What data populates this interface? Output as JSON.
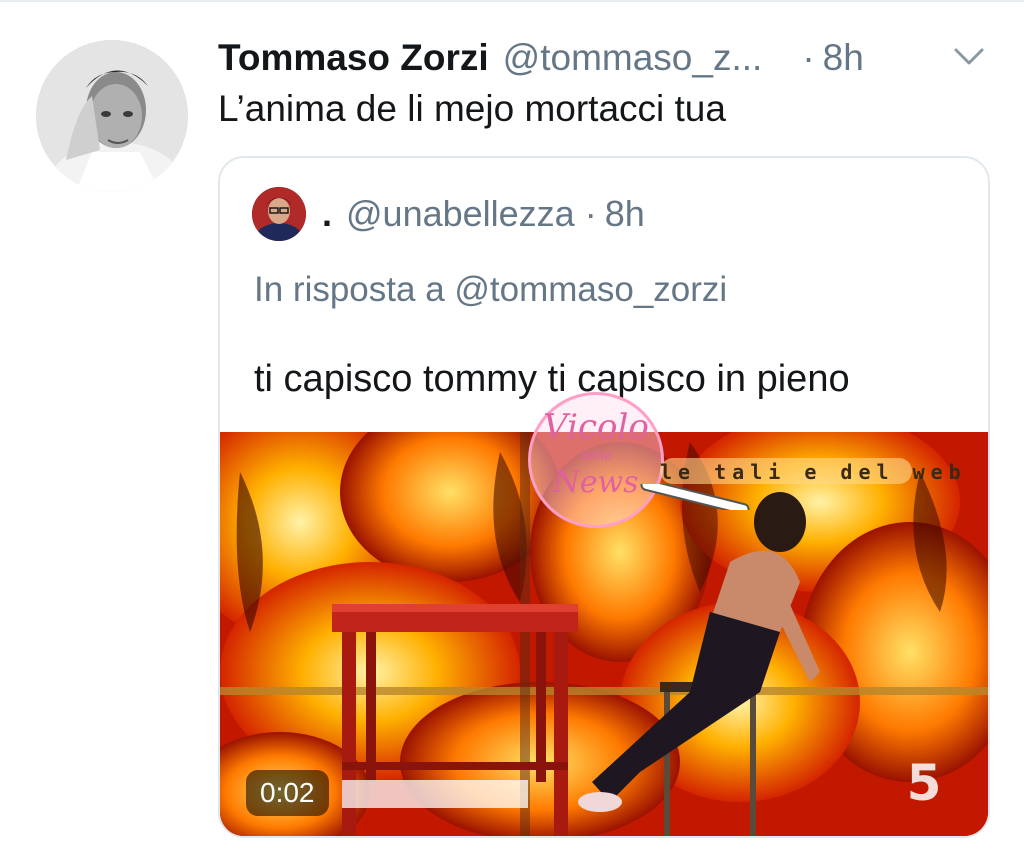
{
  "tweet": {
    "author_name": "Tommaso Zorzi",
    "author_handle": "@tommaso_z...",
    "separator": "·",
    "time": "8h",
    "text": "L’anima de li mejo mortacci tua"
  },
  "quoted_tweet": {
    "author_name": ".",
    "author_handle": "@unabellezza",
    "separator": "·",
    "time": "8h",
    "reply_to": "In risposta a @tommaso_zorzi",
    "text": "ti capisco tommy ti capisco in pieno",
    "media": {
      "duration": "0:02",
      "channel_logo": "5"
    }
  },
  "watermark": {
    "line1": "Vicolo",
    "line2": "delle",
    "line3": "News",
    "tagline": "le tali e del web"
  },
  "icons": {
    "menu": "chevron-down-icon"
  },
  "colors": {
    "text_primary": "#14171a",
    "text_secondary": "#657786",
    "border": "#e1e8ed",
    "watermark_pink": "#e060a0"
  }
}
